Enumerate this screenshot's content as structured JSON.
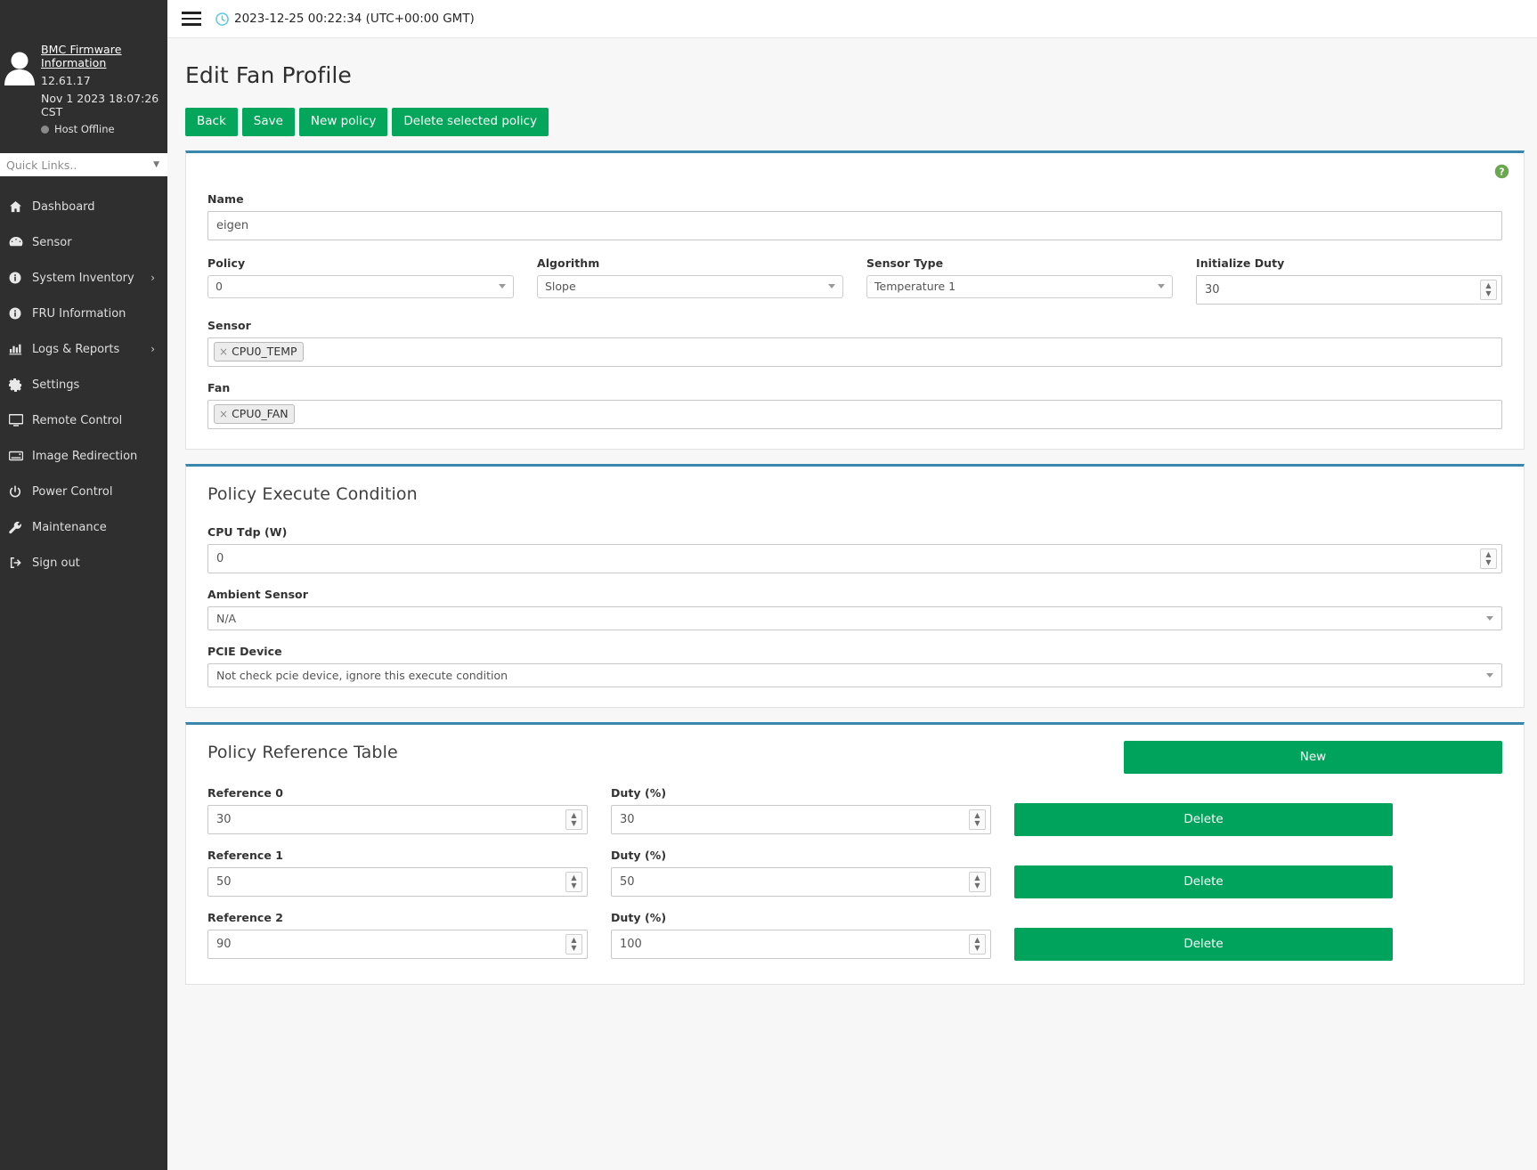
{
  "sidebar": {
    "user": {
      "firmware_title": "BMC Firmware Information",
      "version": "12.61.17",
      "build_date": "Nov 1 2023 18:07:26 CST",
      "host_status": "Host Offline"
    },
    "quick_links": {
      "label": "Quick Links.."
    },
    "items": [
      {
        "label": "Dashboard",
        "icon": "home-icon",
        "chevron": ""
      },
      {
        "label": "Sensor",
        "icon": "gauge-icon",
        "chevron": ""
      },
      {
        "label": "System Inventory",
        "icon": "info-icon",
        "chevron": "›"
      },
      {
        "label": "FRU Information",
        "icon": "info-icon",
        "chevron": ""
      },
      {
        "label": "Logs & Reports",
        "icon": "bar-chart-icon",
        "chevron": "›"
      },
      {
        "label": "Settings",
        "icon": "gear-icon",
        "chevron": ""
      },
      {
        "label": "Remote Control",
        "icon": "monitor-icon",
        "chevron": ""
      },
      {
        "label": "Image Redirection",
        "icon": "disk-icon",
        "chevron": ""
      },
      {
        "label": "Power Control",
        "icon": "power-icon",
        "chevron": ""
      },
      {
        "label": "Maintenance",
        "icon": "wrench-icon",
        "chevron": ""
      },
      {
        "label": "Sign out",
        "icon": "sign-out-icon",
        "chevron": ""
      }
    ]
  },
  "topbar": {
    "timestamp": "2023-12-25 00:22:34 (UTC+00:00 GMT)",
    "clock_icon": "clock-icon",
    "menu_icon": "hamburger-icon"
  },
  "page": {
    "title": "Edit Fan Profile",
    "actions": [
      {
        "label": "Back"
      },
      {
        "label": "Save"
      },
      {
        "label": "New policy"
      },
      {
        "label": "Delete selected policy"
      }
    ]
  },
  "profile_card": {
    "help_icon": "help-circle-icon",
    "name": {
      "label": "Name",
      "value": "eigen"
    },
    "policy": {
      "label": "Policy",
      "value": "0"
    },
    "algorithm": {
      "label": "Algorithm",
      "value": "Slope"
    },
    "sensor_type": {
      "label": "Sensor Type",
      "value": "Temperature 1"
    },
    "initialize_duty": {
      "label": "Initialize Duty",
      "value": "30"
    },
    "sensor": {
      "label": "Sensor",
      "tags": [
        "CPU0_TEMP"
      ]
    },
    "fan": {
      "label": "Fan",
      "tags": [
        "CPU0_FAN"
      ]
    },
    "tag_remove_glyph": "×"
  },
  "execute_condition": {
    "title": "Policy Execute Condition",
    "cpu_tdp": {
      "label": "CPU Tdp (W)",
      "value": "0"
    },
    "ambient_sensor": {
      "label": "Ambient Sensor",
      "value": "N/A"
    },
    "pcie_device": {
      "label": "PCIE Device",
      "value": "Not check pcie device, ignore this execute condition"
    }
  },
  "reference_table": {
    "title": "Policy Reference Table",
    "new_label": "New",
    "rows": [
      {
        "ref_label": "Reference 0",
        "ref_value": "30",
        "duty_label": "Duty (%)",
        "duty_value": "30",
        "delete_label": "Delete"
      },
      {
        "ref_label": "Reference 1",
        "ref_value": "50",
        "duty_label": "Duty (%)",
        "duty_value": "50",
        "delete_label": "Delete"
      },
      {
        "ref_label": "Reference 2",
        "ref_value": "90",
        "duty_label": "Duty (%)",
        "duty_value": "100",
        "delete_label": "Delete"
      }
    ]
  },
  "colors": {
    "accent_green": "#03a65a",
    "card_top_border": "#3a87ad",
    "sidebar_bg": "#2f2f2f",
    "clock_icon": "#5bc8e0"
  }
}
